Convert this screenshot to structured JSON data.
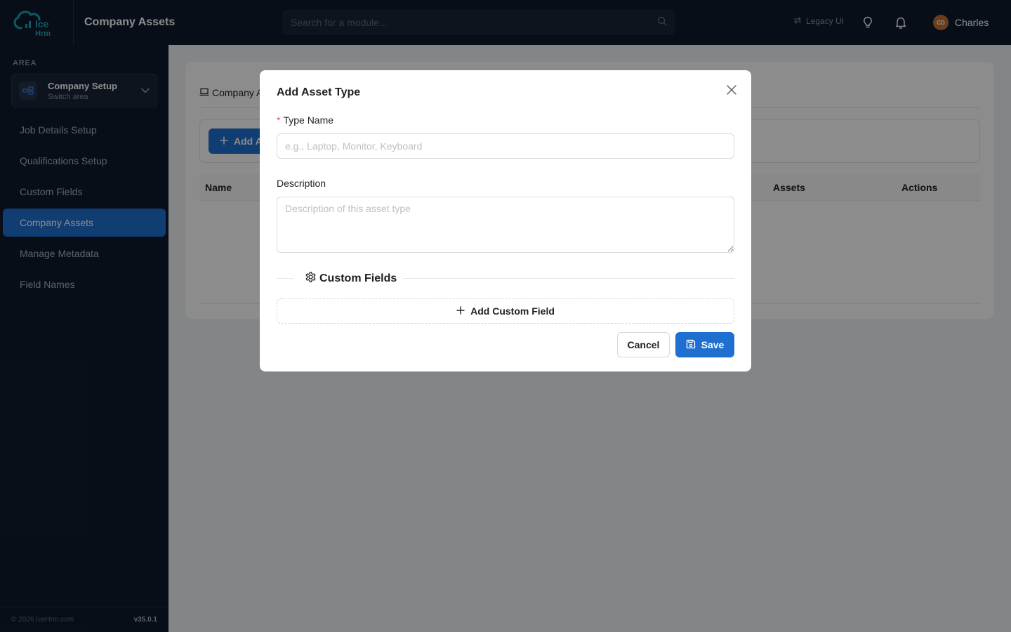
{
  "header": {
    "logo_text": "IceHrm",
    "app_title": "Company Assets",
    "search_placeholder": "Search for a module...",
    "legacy_label": "Legacy UI",
    "user_initials": "CD",
    "user_name": "Charles"
  },
  "sidebar": {
    "area_label": "AREA",
    "area_name": "Company Setup",
    "area_sub": "Switch area",
    "items": [
      {
        "label": "Job Details Setup",
        "active": false
      },
      {
        "label": "Qualifications Setup",
        "active": false
      },
      {
        "label": "Custom Fields",
        "active": false
      },
      {
        "label": "Company Assets",
        "active": true
      },
      {
        "label": "Manage Metadata",
        "active": false
      },
      {
        "label": "Field Names",
        "active": false
      }
    ],
    "copyright": "© 2026 IceHrm.com",
    "version": "v35.0.1"
  },
  "main": {
    "tab_label": "Company A",
    "add_button_label": "Add A",
    "columns": [
      "Name",
      "Assets",
      "Actions"
    ]
  },
  "modal": {
    "title": "Add Asset Type",
    "type_name_label": "Type Name",
    "type_name_placeholder": "e.g., Laptop, Monitor, Keyboard",
    "type_name_value": "",
    "description_label": "Description",
    "description_placeholder": "Description of this asset type",
    "description_value": "",
    "custom_fields_heading": "Custom Fields",
    "add_custom_field_label": "Add Custom Field",
    "cancel_label": "Cancel",
    "save_label": "Save"
  },
  "colors": {
    "primary": "#1e6fd0",
    "sidebar_bg": "#0f1b2d",
    "required": "#ff4d4f"
  },
  "icons": {
    "search": "search-icon",
    "legacy": "swap-icon",
    "tips": "lightbulb-icon",
    "notifications": "bell-icon",
    "area": "area-switch-icon",
    "chevron": "chevron-down-icon",
    "tab": "laptop-icon",
    "close": "close-icon",
    "settings": "gear-icon",
    "plus": "plus-icon",
    "save": "save-icon"
  }
}
